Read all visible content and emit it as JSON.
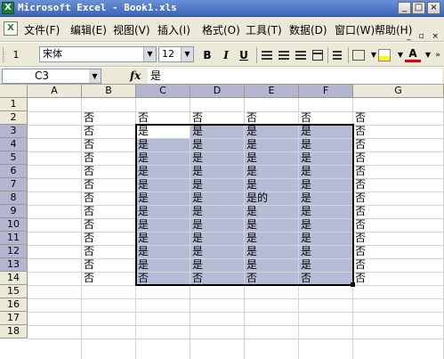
{
  "window": {
    "title": "Microsoft Excel - Book1.xls",
    "icon_letter": "X",
    "buttons": [
      "_",
      "□",
      "×"
    ]
  },
  "menu": {
    "doc_icon_letter": "X",
    "items": [
      "文件(F)",
      "编辑(E)",
      "视图(V)",
      "插入(I)",
      "格式(O)",
      "工具(T)",
      "数据(D)",
      "窗口(W)",
      "帮助(H)"
    ],
    "mdi_buttons": "_ ▫ ×"
  },
  "toolbar": {
    "row_indicator": "1",
    "font_name": "宋体",
    "font_size": "12",
    "bold": "B",
    "italic": "I",
    "underline": "U",
    "font_color_letter": "A"
  },
  "formula_bar": {
    "name_box": "C3",
    "fx_label": "fx",
    "content": "是"
  },
  "sheet": {
    "columns": [
      "A",
      "B",
      "C",
      "D",
      "E",
      "F",
      "G"
    ],
    "selected_columns": [
      "C",
      "D",
      "E",
      "F"
    ],
    "rows": [
      "1",
      "2",
      "3",
      "4",
      "5",
      "6",
      "7",
      "8",
      "9",
      "10",
      "11",
      "12",
      "13",
      "14",
      "15",
      "16",
      "17",
      "18"
    ],
    "selected_rows": [
      "3",
      "4",
      "5",
      "6",
      "7",
      "8",
      "9",
      "10",
      "11",
      "12",
      "13"
    ],
    "active_cell": "C3",
    "selection_range": "C3:F13",
    "cells": [
      [],
      [
        "",
        "否",
        "否",
        "否",
        "否",
        "否",
        "否"
      ],
      [
        "",
        "否",
        "是",
        "是",
        "是",
        "是",
        "否"
      ],
      [
        "",
        "否",
        "是",
        "是",
        "是",
        "是",
        "否"
      ],
      [
        "",
        "否",
        "是",
        "是",
        "是",
        "是",
        "否"
      ],
      [
        "",
        "否",
        "是",
        "是",
        "是",
        "是",
        "否"
      ],
      [
        "",
        "否",
        "是",
        "是",
        "是",
        "是",
        "否"
      ],
      [
        "",
        "否",
        "是",
        "是",
        "是的",
        "是",
        "否"
      ],
      [
        "",
        "否",
        "是",
        "是",
        "是",
        "是",
        "否"
      ],
      [
        "",
        "否",
        "是",
        "是",
        "是",
        "是",
        "否"
      ],
      [
        "",
        "否",
        "是",
        "是",
        "是",
        "是",
        "否"
      ],
      [
        "",
        "否",
        "是",
        "是",
        "是",
        "是",
        "否"
      ],
      [
        "",
        "否",
        "是",
        "是",
        "是",
        "是",
        "否"
      ],
      [
        "",
        "否",
        "否",
        "否",
        "否",
        "否",
        "否"
      ],
      [],
      [],
      [],
      []
    ]
  }
}
